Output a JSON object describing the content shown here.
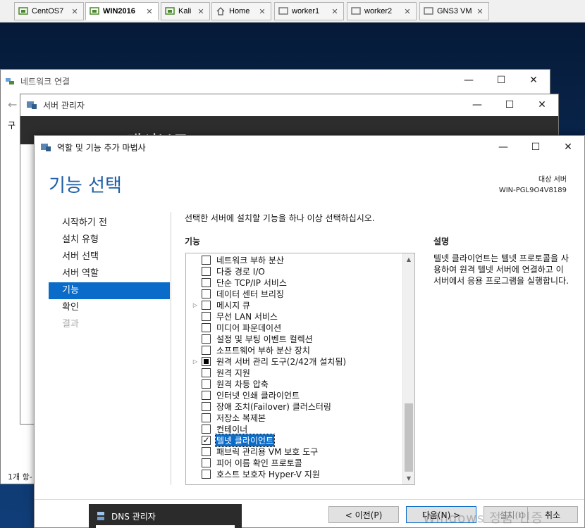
{
  "vm_tabs": [
    {
      "label": "CentOS7",
      "icon": "vm-icon",
      "active": false
    },
    {
      "label": "WIN2016",
      "icon": "vm-icon",
      "active": true
    },
    {
      "label": "Kali",
      "icon": "vm-icon",
      "active": false
    },
    {
      "label": "Home",
      "icon": "home-icon",
      "active": false
    },
    {
      "label": "worker1",
      "icon": "vm-icon",
      "active": false
    },
    {
      "label": "worker2",
      "icon": "vm-icon",
      "active": false
    },
    {
      "label": "GNS3 VM",
      "icon": "vm-icon",
      "active": false
    }
  ],
  "network_window": {
    "title": "네트워크 연결",
    "status": "1개 항-",
    "side_label": "구"
  },
  "server_manager": {
    "title": "서버 관리자",
    "dashboard": "대시보드"
  },
  "wizard": {
    "title": "역할 및 기능 추가 마법사",
    "heading": "기능 선택",
    "destination_label": "대상 서버",
    "destination_server": "WIN-PGL9O4V8189",
    "nav": [
      {
        "label": "시작하기 전",
        "state": "normal"
      },
      {
        "label": "설치 유형",
        "state": "normal"
      },
      {
        "label": "서버 선택",
        "state": "normal"
      },
      {
        "label": "서버 역할",
        "state": "normal"
      },
      {
        "label": "기능",
        "state": "active"
      },
      {
        "label": "확인",
        "state": "normal"
      },
      {
        "label": "결과",
        "state": "disabled"
      }
    ],
    "instruction": "선택한 서버에 설치할 기능을 하나 이상 선택하십시오.",
    "features_label": "기능",
    "features": [
      {
        "label": "네트워크 부하 분산",
        "state": "unchecked",
        "expandable": false
      },
      {
        "label": "다중 경로 I/O",
        "state": "unchecked",
        "expandable": false
      },
      {
        "label": "단순 TCP/IP 서비스",
        "state": "unchecked",
        "expandable": false
      },
      {
        "label": "데이터 센터 브리징",
        "state": "unchecked",
        "expandable": false
      },
      {
        "label": "메시지 큐",
        "state": "unchecked",
        "expandable": true
      },
      {
        "label": "무선 LAN 서비스",
        "state": "unchecked",
        "expandable": false
      },
      {
        "label": "미디어 파운데이션",
        "state": "unchecked",
        "expandable": false
      },
      {
        "label": "설정 및 부팅 이벤트 컬렉션",
        "state": "unchecked",
        "expandable": false
      },
      {
        "label": "소프트웨어 부하 분산 장치",
        "state": "unchecked",
        "expandable": false
      },
      {
        "label": "원격 서버 관리 도구(2/42개 설치됨)",
        "state": "partial",
        "expandable": true
      },
      {
        "label": "원격 지원",
        "state": "unchecked",
        "expandable": false
      },
      {
        "label": "원격 차등 압축",
        "state": "unchecked",
        "expandable": false
      },
      {
        "label": "인터넷 인쇄 클라이언트",
        "state": "unchecked",
        "expandable": false
      },
      {
        "label": "장애 조치(Failover) 클러스터링",
        "state": "unchecked",
        "expandable": false
      },
      {
        "label": "저장소 복제본",
        "state": "unchecked",
        "expandable": false
      },
      {
        "label": "컨테이너",
        "state": "unchecked",
        "expandable": false
      },
      {
        "label": "텔넷 클라이언트",
        "state": "checked",
        "expandable": false,
        "selected": true
      },
      {
        "label": "패브릭 관리용 VM 보호 도구",
        "state": "unchecked",
        "expandable": false
      },
      {
        "label": "피어 이름 확인 프로토콜",
        "state": "unchecked",
        "expandable": false
      },
      {
        "label": "호스트 보호자 Hyper-V 지원",
        "state": "unchecked",
        "expandable": false
      }
    ],
    "description_label": "설명",
    "description": "텔넷 클라이언트는 텔넷 프로토콜을 사용하여 원격 텔넷 서버에 연결하고 이 서버에서 응용 프로그램을 실행합니다.",
    "buttons": {
      "previous": "< 이전(P)",
      "next": "다음(N) >",
      "install": "설치(I)",
      "cancel": "취소"
    }
  },
  "taskbar_popup": {
    "title": "DNS 관리자"
  },
  "watermark": "Windows 정품 인증",
  "colors": {
    "accent": "#0a6cc8",
    "heading": "#1f5fa6",
    "desktop": "#0d3468"
  }
}
